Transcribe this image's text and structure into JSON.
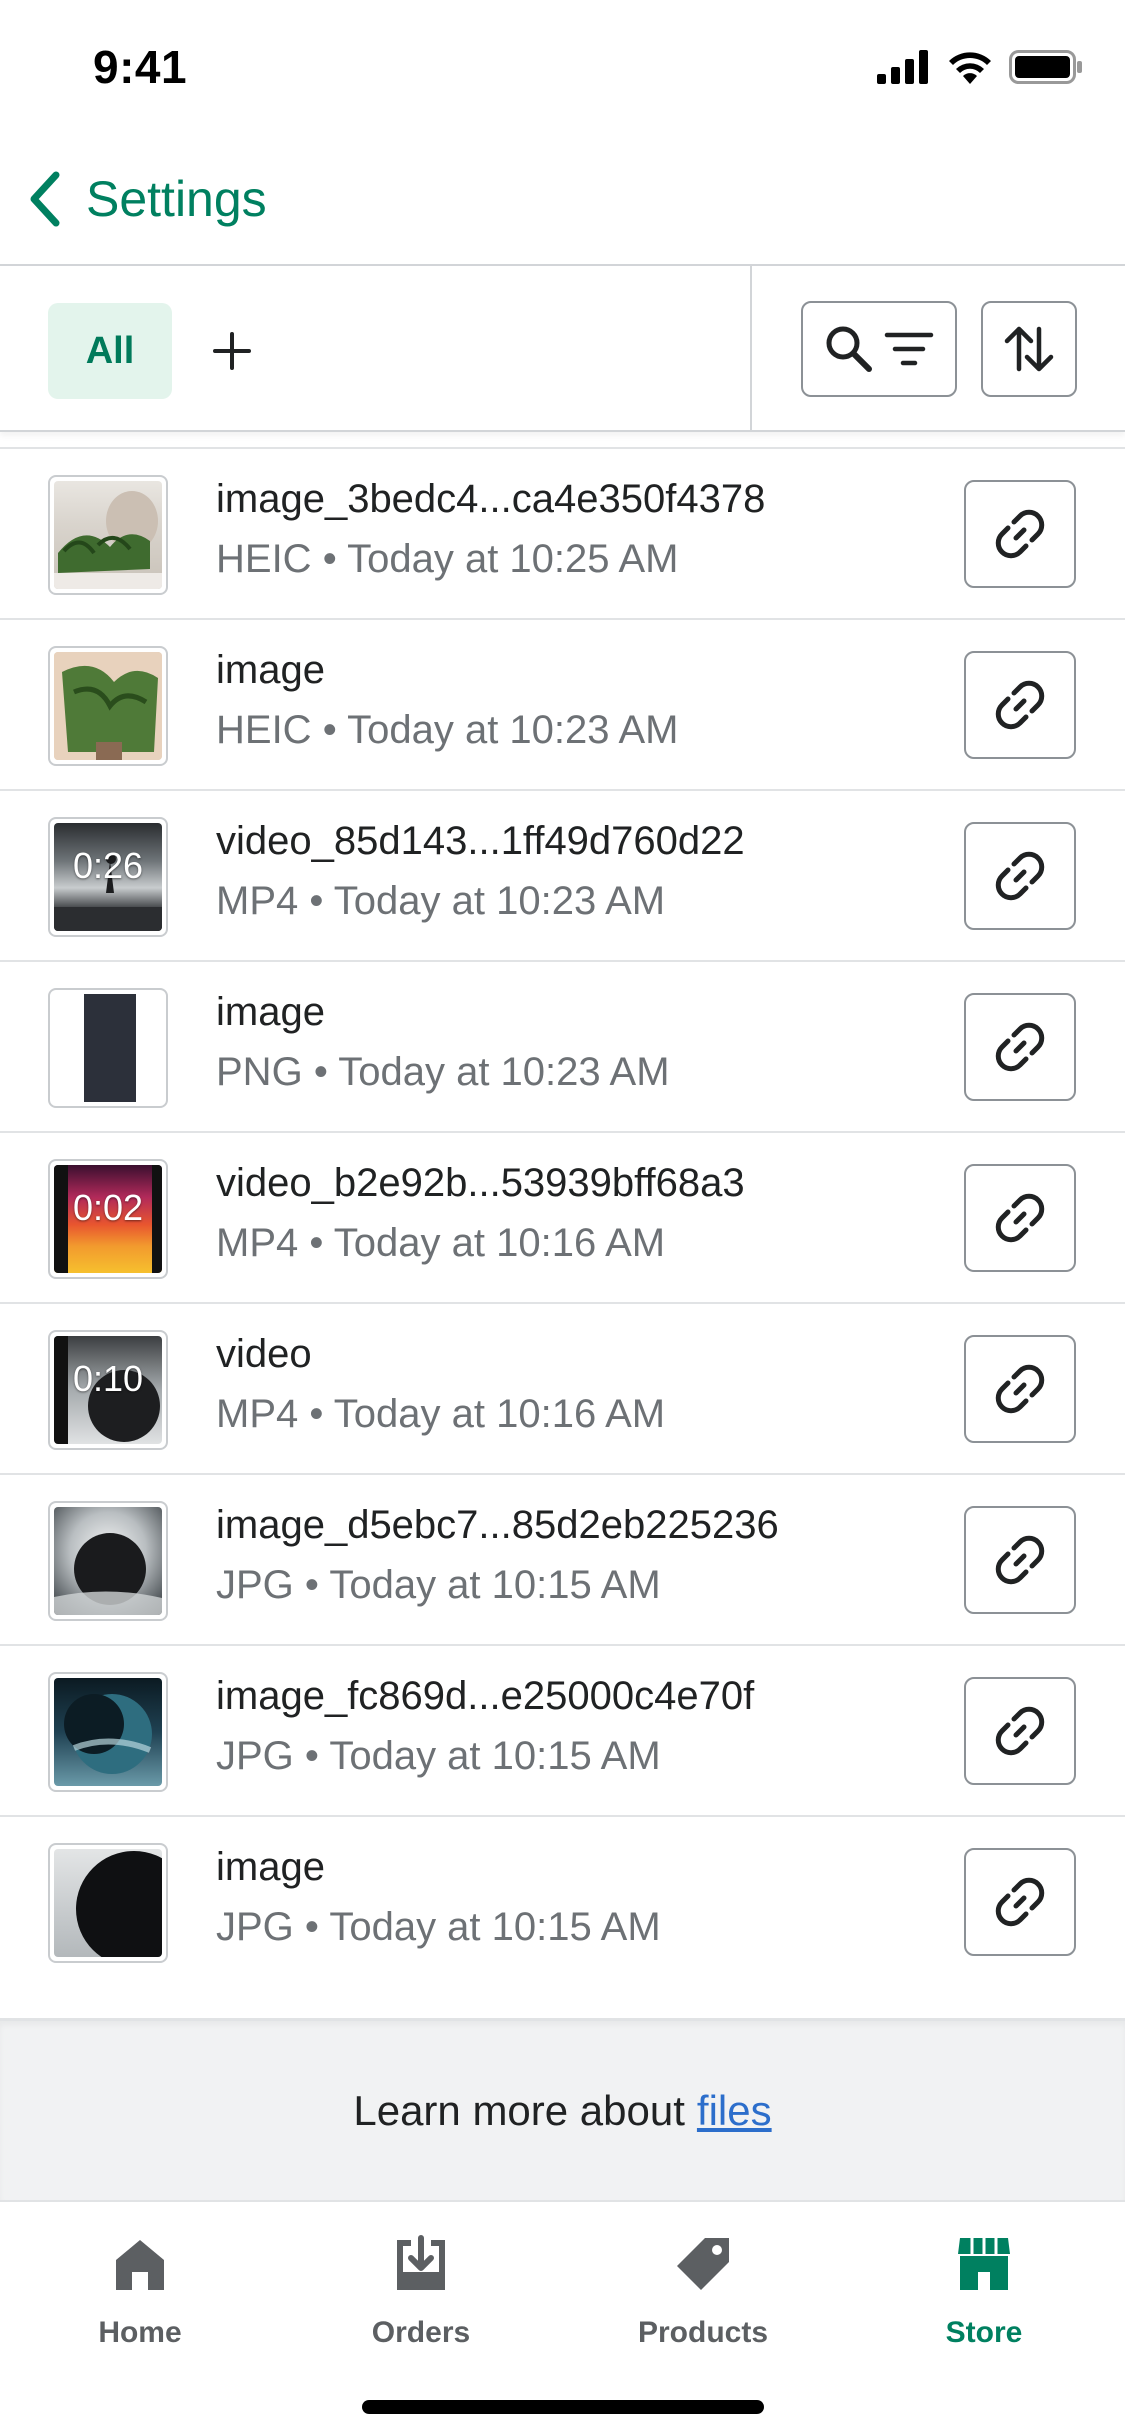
{
  "status_bar": {
    "time": "9:41"
  },
  "nav": {
    "back_label": "Settings"
  },
  "toolbar": {
    "tab_all_label": "All"
  },
  "files": [
    {
      "name": "image_3bedc4...ca4e350f4378",
      "type": "HEIC",
      "time": "Today at 10:25 AM",
      "thumb": "plant-on-white"
    },
    {
      "name": "image",
      "type": "HEIC",
      "time": "Today at 10:23 AM",
      "thumb": "plant-vertical"
    },
    {
      "name": "video_85d143...1ff49d760d22",
      "type": "MP4",
      "time": "Today at 10:23 AM",
      "thumb": "video-silhouette",
      "duration": "0:26"
    },
    {
      "name": "image",
      "type": "PNG",
      "time": "Today at 10:23 AM",
      "thumb": "dark-bar"
    },
    {
      "name": "video_b2e92b...53939bff68a3",
      "type": "MP4",
      "time": "Today at 10:16 AM",
      "thumb": "video-warm-gradient",
      "duration": "0:02"
    },
    {
      "name": "video",
      "type": "MP4",
      "time": "Today at 10:16 AM",
      "thumb": "video-sphere",
      "duration": "0:10"
    },
    {
      "name": "image_d5ebc7...85d2eb225236",
      "type": "JPG",
      "time": "Today at 10:15 AM",
      "thumb": "sphere-cloudy"
    },
    {
      "name": "image_fc869d...e25000c4e70f",
      "type": "JPG",
      "time": "Today at 10:15 AM",
      "thumb": "sphere-blue"
    },
    {
      "name": "image",
      "type": "JPG",
      "time": "Today at 10:15 AM",
      "thumb": "sphere-dark"
    }
  ],
  "meta_separator": "•",
  "footer": {
    "learn_more_text": "Learn more about",
    "learn_more_link": "files"
  },
  "tab_bar": {
    "items": [
      {
        "label": "Home",
        "icon": "home-icon",
        "active": false
      },
      {
        "label": "Orders",
        "icon": "orders-icon",
        "active": false
      },
      {
        "label": "Products",
        "icon": "tag-icon",
        "active": false
      },
      {
        "label": "Store",
        "icon": "store-icon",
        "active": true
      }
    ]
  },
  "colors": {
    "accent": "#008060",
    "tab_all_bg": "#e3f4ec",
    "link": "#2c6ecb",
    "muted_text": "#6d7175"
  }
}
